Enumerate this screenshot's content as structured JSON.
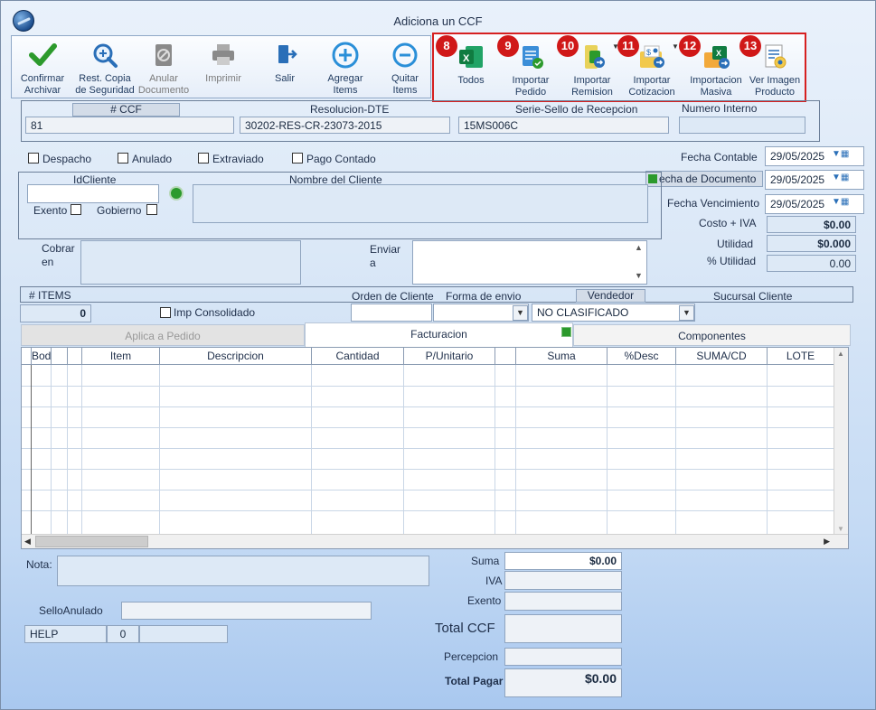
{
  "window": {
    "title": "Adiciona un CCF"
  },
  "toolbar": {
    "buttons": [
      {
        "id": "confirm",
        "label1": "Confirmar",
        "label2": "Archivar",
        "icon": "checkmark-icon"
      },
      {
        "id": "restore",
        "label1": "Rest. Copia",
        "label2": "de Seguridad",
        "icon": "magnify-plus-icon"
      },
      {
        "id": "annul",
        "label1": "Anular",
        "label2": "Documento",
        "icon": "annul-document-icon"
      },
      {
        "id": "print",
        "label1": "Imprimir",
        "label2": "",
        "icon": "printer-icon"
      },
      {
        "id": "exit",
        "label1": "Salir",
        "label2": "",
        "icon": "exit-door-icon"
      },
      {
        "id": "add",
        "label1": "Agregar",
        "label2": "Items",
        "icon": "plus-circle-icon"
      },
      {
        "id": "remove",
        "label1": "Quitar",
        "label2": "Items",
        "icon": "minus-circle-icon"
      }
    ],
    "import_buttons": [
      {
        "badge": "8",
        "label1": "Todos",
        "label2": "",
        "icon": "excel-icon"
      },
      {
        "badge": "9",
        "label1": "Importar",
        "label2": "Pedido",
        "icon": "import-order-icon"
      },
      {
        "badge": "10",
        "label1": "Importar",
        "label2": "Remision",
        "icon": "import-remision-icon"
      },
      {
        "badge": "11",
        "label1": "Importar",
        "label2": "Cotizacion",
        "icon": "import-quote-icon"
      },
      {
        "badge": "12",
        "label1": "Importacion",
        "label2": "Masiva",
        "icon": "bulk-import-icon"
      },
      {
        "badge": "13",
        "label1": "Ver Imagen",
        "label2": "Producto",
        "icon": "view-image-icon"
      }
    ]
  },
  "header": {
    "ccf_label": "# CCF",
    "ccf_value": "81",
    "resolucion_label": "Resolucion-DTE",
    "resolucion_value": "30202-RES-CR-23073-2015",
    "serie_label": "Serie-Sello de Recepcion",
    "serie_value": "15MS006C",
    "numero_interno_label": "Numero Interno",
    "numero_interno_value": ""
  },
  "flags": {
    "despacho": "Despacho",
    "anulado": "Anulado",
    "extraviado": "Extraviado",
    "pago_contado": "Pago Contado"
  },
  "dates": {
    "contable_label": "Fecha Contable",
    "contable_value": "29/05/2025",
    "documento_label": "echa de  Documento",
    "documento_value": "29/05/2025",
    "vencimiento_label": "Fecha Vencimiento",
    "vencimiento_value": "29/05/2025"
  },
  "client": {
    "id_label": "IdCliente",
    "name_label": "Nombre del Cliente",
    "exento": "Exento",
    "gobierno": "Gobierno",
    "cobrar_label1": "Cobrar",
    "cobrar_label2": "en",
    "enviar_label1": "Enviar",
    "enviar_label2": "a"
  },
  "costs": {
    "costo_label": "Costo + IVA",
    "costo_value": "$0.00",
    "utilidad_label": "Utilidad",
    "utilidad_value": "$0.000",
    "pct_label": "% Utilidad",
    "pct_value": "0.00"
  },
  "items_bar": {
    "items_label": "# ITEMS",
    "items_value": "0",
    "imp_consolidado": "Imp Consolidado",
    "orden_label": "Orden de Cliente",
    "envio_label": "Forma de envio",
    "vendedor_label": "Vendedor",
    "vendedor_value": "NO CLASIFICADO",
    "sucursal_label": "Sucursal Cliente"
  },
  "tabs": [
    "Aplica a Pedido",
    "Facturacion",
    "Componentes"
  ],
  "grid": {
    "columns": [
      "Bodega",
      "",
      "Item",
      "Descripcion",
      "Cantidad",
      "P/Unitario",
      "",
      "Suma",
      "%Desc",
      "SUMA/CD",
      "LOTE"
    ]
  },
  "footer": {
    "nota_label": "Nota:",
    "sello_label": "SelloAnulado",
    "help_label": "HELP",
    "help_count": "0",
    "suma_label": "Suma",
    "suma_value": "$0.00",
    "iva_label": "IVA",
    "exento_label": "Exento",
    "total_ccf_label": "Total CCF",
    "percepcion_label": "Percepcion",
    "total_pagar_label": "Total Pagar",
    "total_pagar_value": "$0.00"
  }
}
